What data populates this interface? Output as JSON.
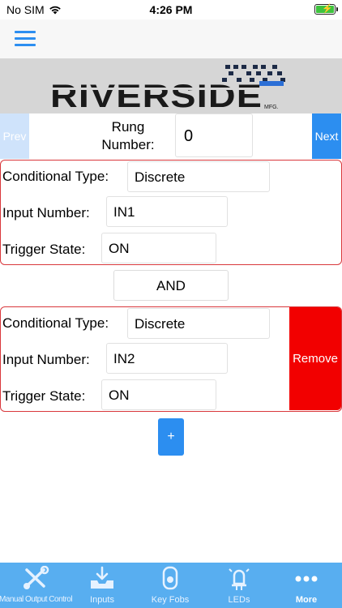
{
  "status": {
    "carrier": "No SIM",
    "time": "4:26 PM"
  },
  "colors": {
    "accent": "#2c8ef0",
    "error": "#d9383c",
    "remove": "#f20000",
    "tabbar": "#58aef0"
  },
  "logo_text": "RIVERSIDE",
  "logo_sub": "MFG.",
  "rung": {
    "prev_label": "Prev",
    "next_label": "Next",
    "label": "Rung Number:",
    "value": "0"
  },
  "conditionals": [
    {
      "type_label": "Conditional Type:",
      "type_value": "Discrete",
      "input_label": "Input Number:",
      "input_value": "IN1",
      "trigger_label": "Trigger State:",
      "trigger_value": "ON"
    },
    {
      "type_label": "Conditional Type:",
      "type_value": "Discrete",
      "input_label": "Input Number:",
      "input_value": "IN2",
      "trigger_label": "Trigger State:",
      "trigger_value": "ON",
      "remove_label": "Remove"
    }
  ],
  "operator_label": "AND",
  "add_label": "+",
  "tabs": [
    {
      "label": "Manual Output Control",
      "icon": "tools-icon"
    },
    {
      "label": "Inputs",
      "icon": "inbox-icon"
    },
    {
      "label": "Key Fobs",
      "icon": "key-fob-icon"
    },
    {
      "label": "LEDs",
      "icon": "led-icon"
    },
    {
      "label": "More",
      "icon": "more-icon",
      "active": true
    }
  ]
}
